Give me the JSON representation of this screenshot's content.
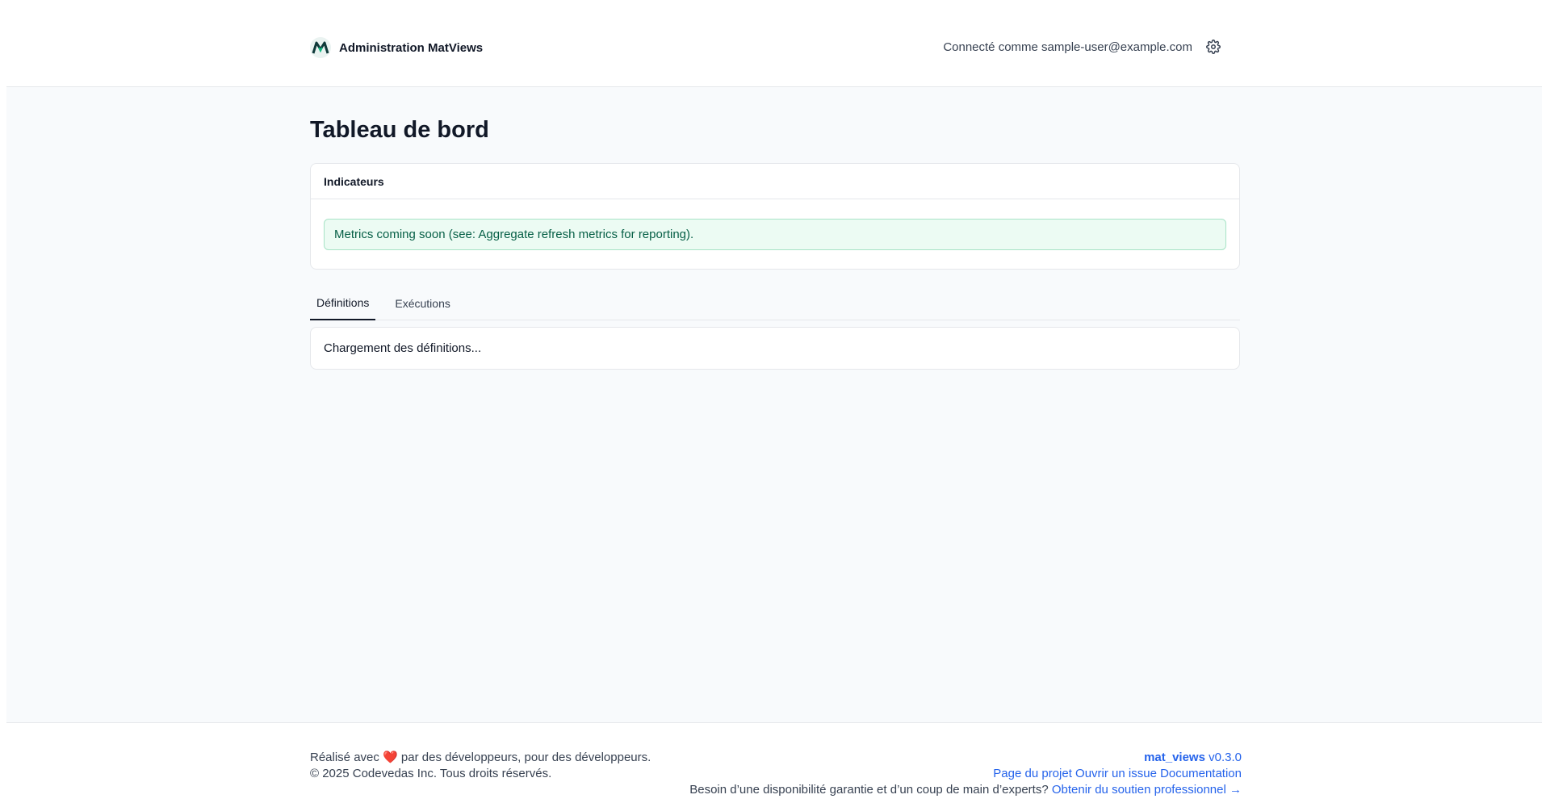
{
  "header": {
    "brand_name": "Administration MatViews",
    "logo_letter": "M",
    "user_text": "Connecté comme sample-user@example.com"
  },
  "page": {
    "title": "Tableau de bord"
  },
  "metrics_card": {
    "title": "Indicateurs",
    "alert_text": "Metrics coming soon (see: Aggregate refresh metrics for reporting)."
  },
  "tabs": [
    {
      "label": "Définitions",
      "active": true
    },
    {
      "label": "Exécutions",
      "active": false
    }
  ],
  "definitions": {
    "loading_text": "Chargement des définitions..."
  },
  "footer": {
    "made_with_prefix": "Réalisé avec",
    "heart_glyph": "❤️",
    "made_with_suffix": "par des développeurs, pour des développeurs.",
    "copyright": "© 2025 Codevedas Inc. Tous droits réservés.",
    "package_name": "mat_views",
    "version": "v0.3.0",
    "links": {
      "project_page": "Page du projet",
      "open_issue": "Ouvrir un issue",
      "documentation": "Documentation"
    },
    "support_prompt": "Besoin d’une disponibilité garantie et d’un coup de main d’experts?",
    "support_link": "Obtenir du soutien professionnel →"
  },
  "colors": {
    "accent_link": "#2563eb",
    "alert_bg": "#ecfbf3",
    "alert_border": "#a7e3c6",
    "alert_text": "#065f46",
    "heart": "#dc2626"
  },
  "icons": {
    "logo": "matviews-logo-icon",
    "settings": "gear-icon"
  }
}
